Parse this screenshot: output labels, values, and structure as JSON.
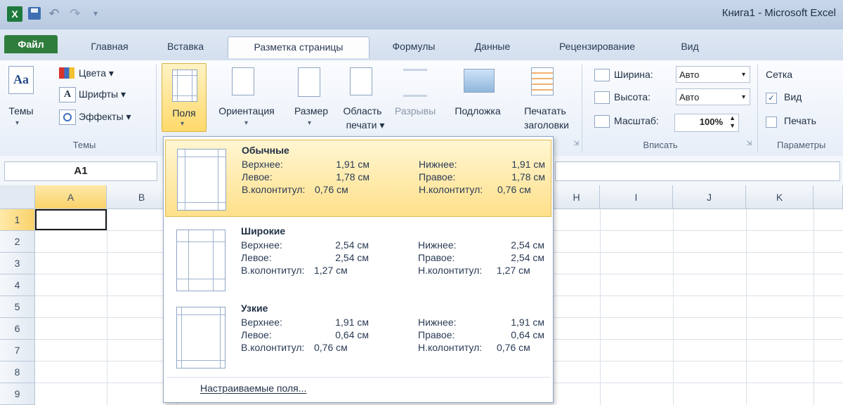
{
  "titlebar": {
    "logo": "X",
    "app_title": "Книга1 - Microsoft Excel",
    "undo_icon": "undo-icon",
    "redo_icon": "redo-icon"
  },
  "tabs": [
    {
      "label": "Файл"
    },
    {
      "label": "Главная"
    },
    {
      "label": "Вставка"
    },
    {
      "label": "Разметка страницы",
      "active": true
    },
    {
      "label": "Формулы"
    },
    {
      "label": "Данные"
    },
    {
      "label": "Рецензирование"
    },
    {
      "label": "Вид"
    }
  ],
  "ribbon": {
    "themes": {
      "button": "Темы",
      "colors": "Цвета",
      "fonts": "Шрифты",
      "effects": "Эффекты",
      "group": "Темы"
    },
    "page_setup": {
      "margins": "Поля",
      "orientation": "Ориентация",
      "size": "Размер",
      "print_area": [
        "Область",
        "печати"
      ],
      "breaks": "Разрывы",
      "background": "Подложка",
      "print_titles": [
        "Печатать",
        "заголовки"
      ]
    },
    "scale_to_fit": {
      "width_label": "Ширина:",
      "width_value": "Авто",
      "height_label": "Высота:",
      "height_value": "Авто",
      "scale_label": "Масштаб:",
      "scale_value": "100%",
      "group": "Вписать"
    },
    "sheet_options": {
      "gridlines": "Сетка",
      "view": "Вид",
      "print": "Печать",
      "group": "Параметры"
    }
  },
  "formula_bar": {
    "name_box": "A1"
  },
  "grid": {
    "columns": [
      "A",
      "B",
      "H",
      "I",
      "J",
      "K"
    ],
    "rows": [
      "1",
      "2",
      "3",
      "4",
      "5",
      "6",
      "7",
      "8",
      "9"
    ]
  },
  "margins_menu": {
    "options": [
      {
        "title": "Обычные",
        "top_label": "Верхнее:",
        "top": "1,91 см",
        "bottom_label": "Нижнее:",
        "bottom": "1,91 см",
        "left_label": "Левое:",
        "left": "1,78 см",
        "right_label": "Правое:",
        "right": "1,78 см",
        "header_label": "В.колонтитул:",
        "header": "0,76 см",
        "footer_label": "Н.колонтитул:",
        "footer": "0,76 см"
      },
      {
        "title": "Широкие",
        "top_label": "Верхнее:",
        "top": "2,54 см",
        "bottom_label": "Нижнее:",
        "bottom": "2,54 см",
        "left_label": "Левое:",
        "left": "2,54 см",
        "right_label": "Правое:",
        "right": "2,54 см",
        "header_label": "В.колонтитул:",
        "header": "1,27 см",
        "footer_label": "Н.колонтитул:",
        "footer": "1,27 см"
      },
      {
        "title": "Узкие",
        "top_label": "Верхнее:",
        "top": "1,91 см",
        "bottom_label": "Нижнее:",
        "bottom": "1,91 см",
        "left_label": "Левое:",
        "left": "0,64 см",
        "right_label": "Правое:",
        "right": "0,64 см",
        "header_label": "В.колонтитул:",
        "header": "0,76 см",
        "footer_label": "Н.колонтитул:",
        "footer": "0,76 см"
      }
    ],
    "custom": "Настраиваемые поля..."
  },
  "colors": {
    "file_tab": "#2f7d3d",
    "highlight": "#ffe08a",
    "ribbon_border": "#a9bbd3"
  }
}
